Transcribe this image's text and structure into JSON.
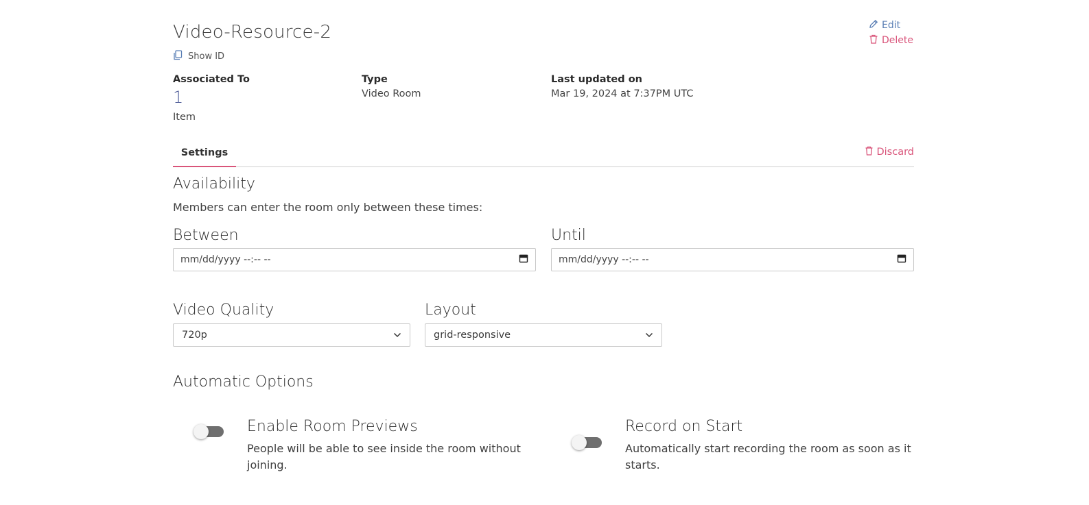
{
  "resource": {
    "title": "Video-Resource-2",
    "show_id_label": "Show ID"
  },
  "actions": {
    "edit_label": "Edit",
    "delete_label": "Delete"
  },
  "meta": {
    "associated_label": "Associated To",
    "associated_count": "1",
    "associated_unit": "Item",
    "type_label": "Type",
    "type_value": "Video Room",
    "updated_label": "Last updated on",
    "updated_value": "Mar 19, 2024 at 7:37PM UTC"
  },
  "tabs": {
    "settings_label": "Settings",
    "discard_label": "Discard"
  },
  "availability": {
    "heading": "Availability",
    "description": "Members can enter the room only between these times:",
    "between_label": "Between",
    "between_value": "mm/dd/yyyy --:-- --",
    "until_label": "Until",
    "until_value": "mm/dd/yyyy --:-- --"
  },
  "video": {
    "quality_label": "Video Quality",
    "quality_value": "720p",
    "layout_label": "Layout",
    "layout_value": "grid-responsive"
  },
  "automatic": {
    "heading": "Automatic Options",
    "previews_title": "Enable Room Previews",
    "previews_desc_line1": "People will be able to see inside the room without",
    "previews_desc_line2": "joining.",
    "previews_enabled": false,
    "record_title": "Record on Start",
    "record_desc_line1": "Automatically start recording the room as soon as it",
    "record_desc_line2": "starts.",
    "record_enabled": false
  },
  "colors": {
    "accent_pink": "#d9547a",
    "link_blue": "#5b7fb5",
    "count_blue": "#4a5896"
  }
}
